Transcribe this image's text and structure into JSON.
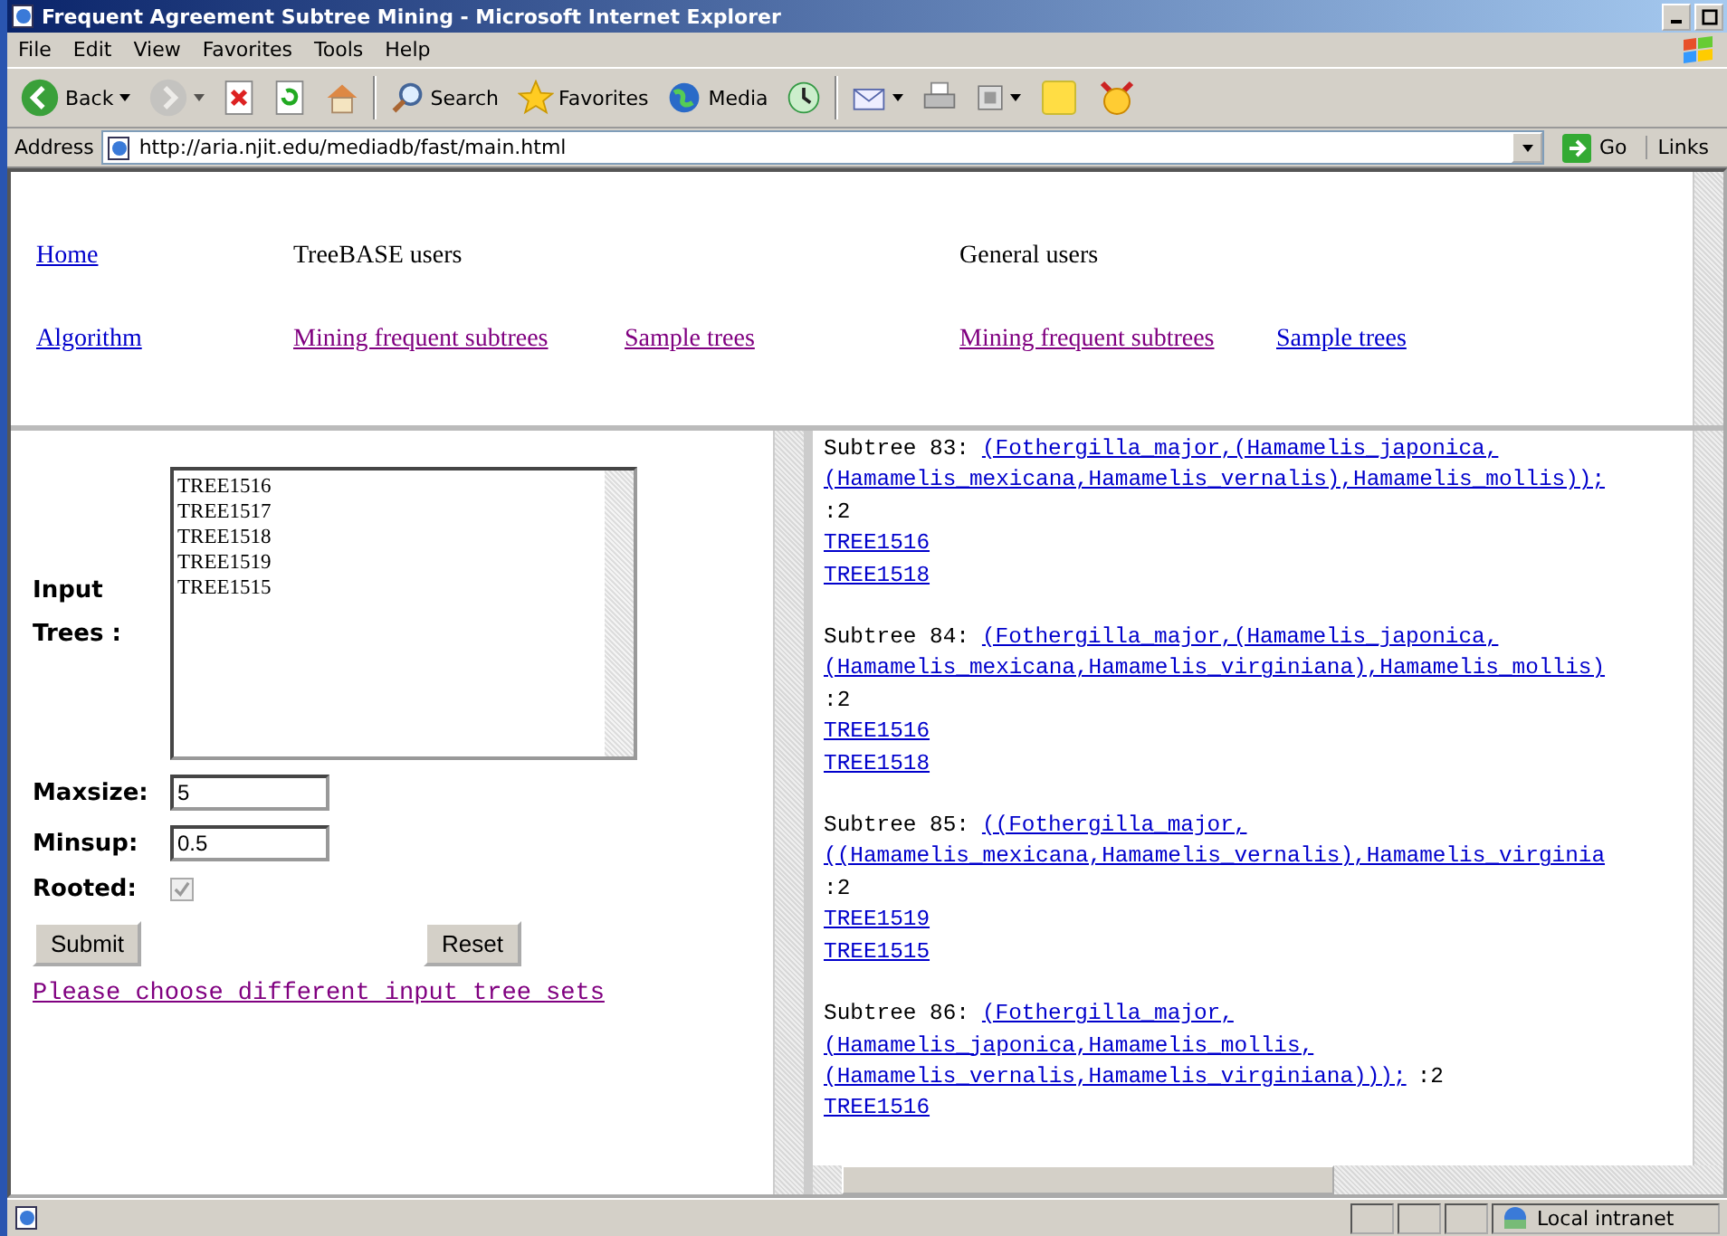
{
  "window": {
    "title": "Frequent Agreement Subtree Mining - Microsoft Internet Explorer"
  },
  "menu": [
    "File",
    "Edit",
    "View",
    "Favorites",
    "Tools",
    "Help"
  ],
  "toolbar": [
    {
      "kind": "back",
      "label": "Back",
      "dropdown": true,
      "disabled": false
    },
    {
      "kind": "forward",
      "dropdown": true,
      "disabled": true
    },
    {
      "kind": "stop",
      "dropdown": false,
      "disabled": false
    },
    {
      "kind": "refresh",
      "dropdown": false,
      "disabled": false
    },
    {
      "kind": "home",
      "dropdown": false,
      "disabled": false
    },
    {
      "kind": "separator"
    },
    {
      "kind": "search",
      "label": "Search",
      "dropdown": false,
      "disabled": false
    },
    {
      "kind": "favorites",
      "label": "Favorites",
      "dropdown": false,
      "disabled": false
    },
    {
      "kind": "media",
      "label": "Media",
      "dropdown": false,
      "disabled": false
    },
    {
      "kind": "history",
      "dropdown": false,
      "disabled": false
    },
    {
      "kind": "separator"
    },
    {
      "kind": "mail",
      "dropdown": true,
      "disabled": false
    },
    {
      "kind": "print",
      "dropdown": false,
      "disabled": false
    },
    {
      "kind": "edit",
      "dropdown": true,
      "disabled": false
    },
    {
      "kind": "note",
      "dropdown": false,
      "disabled": false
    },
    {
      "kind": "messenger",
      "dropdown": false,
      "disabled": false
    }
  ],
  "address": {
    "label": "Address",
    "url": "http://aria.njit.edu/mediadb/fast/main.html",
    "go": "Go",
    "links": "Links"
  },
  "nav": {
    "row1": [
      {
        "kind": "link",
        "text": "Home",
        "visited": false
      },
      {
        "kind": "text",
        "text": "TreeBASE users"
      },
      {
        "kind": "blank"
      },
      {
        "kind": "text",
        "text": "General users"
      },
      {
        "kind": "blank"
      }
    ],
    "row2": [
      {
        "kind": "link",
        "text": "Algorithm",
        "visited": false
      },
      {
        "kind": "link",
        "text": "Mining frequent subtrees",
        "visited": true
      },
      {
        "kind": "link",
        "text": "Sample trees",
        "visited": true
      },
      {
        "kind": "link",
        "text": "Mining frequent subtrees",
        "visited": true
      },
      {
        "kind": "link",
        "text": "Sample trees",
        "visited": false
      }
    ]
  },
  "form": {
    "input_trees_label": "Input Trees :",
    "trees": [
      "TREE1516",
      "TREE1517",
      "TREE1518",
      "TREE1519",
      "TREE1515"
    ],
    "maxsize_label": "Maxsize:",
    "maxsize": "5",
    "minsup_label": "Minsup:",
    "minsup": "0.5",
    "rooted_label": "Rooted:",
    "rooted": {
      "checked": true,
      "disabled": true
    },
    "submit": "Submit",
    "reset": "Reset",
    "message": {
      "text": "Please choose different input tree sets",
      "visited": true
    }
  },
  "results": [
    {
      "label": "Subtree 83:",
      "lines": [
        "(Fothergilla_major,(Hamamelis_japonica,",
        "(Hamamelis_mexicana,Hamamelis_vernalis),Hamamelis_mollis));"
      ],
      "support": ":2",
      "support_inline": false,
      "trees": [
        "TREE1516",
        "TREE1518"
      ]
    },
    {
      "label": "Subtree 84:",
      "lines": [
        "(Fothergilla_major,(Hamamelis_japonica,",
        "(Hamamelis_mexicana,Hamamelis_virginiana),Hamamelis_mollis)"
      ],
      "support": ":2",
      "support_inline": false,
      "trees": [
        "TREE1516",
        "TREE1518"
      ]
    },
    {
      "label": "Subtree 85:",
      "lines": [
        "((Fothergilla_major,",
        "((Hamamelis_mexicana,Hamamelis_vernalis),Hamamelis_virginia"
      ],
      "support": ":2",
      "support_inline": false,
      "trees": [
        "TREE1519",
        "TREE1515"
      ]
    },
    {
      "label": "Subtree 86:",
      "lines": [
        "(Fothergilla_major,",
        "(Hamamelis_japonica,Hamamelis_mollis,",
        "(Hamamelis_vernalis,Hamamelis_virginiana)));"
      ],
      "support": ":2",
      "support_inline": true,
      "trees": [
        "TREE1516"
      ]
    }
  ],
  "status_bar": {
    "zone": "Local intranet"
  }
}
